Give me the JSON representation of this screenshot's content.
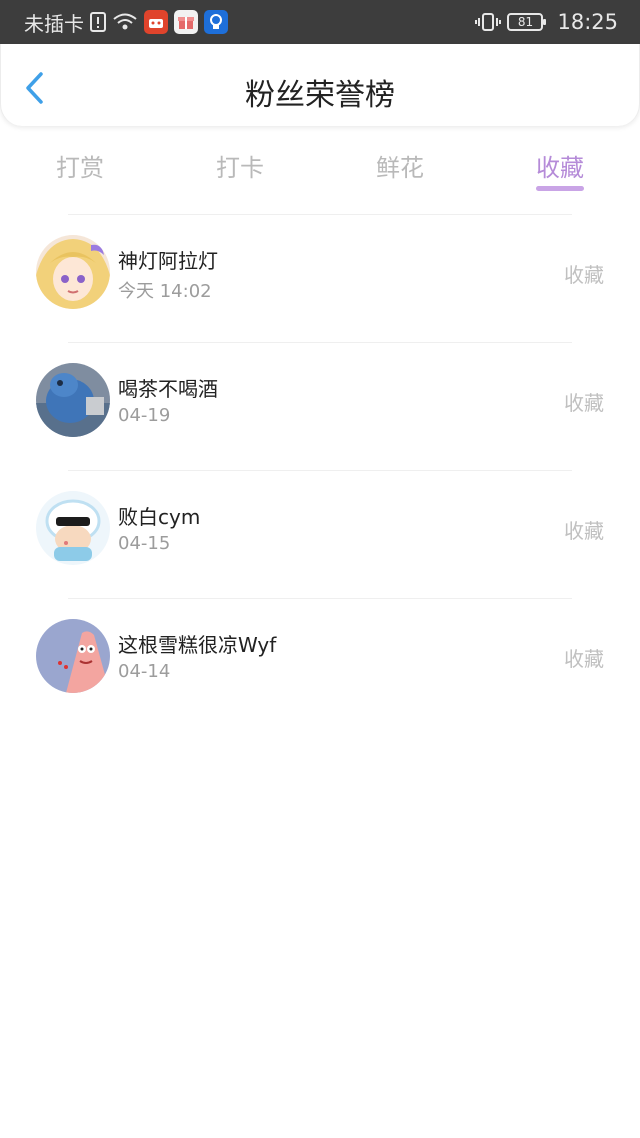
{
  "status_bar": {
    "carrier": "未插卡",
    "battery": "81",
    "time": "18:25"
  },
  "header": {
    "title": "粉丝荣誉榜"
  },
  "tabs": [
    {
      "label": "打赏",
      "active": false
    },
    {
      "label": "打卡",
      "active": false
    },
    {
      "label": "鲜花",
      "active": false
    },
    {
      "label": "收藏",
      "active": true
    }
  ],
  "colors": {
    "accent": "#b58bd8",
    "underline": "#c9a4e6",
    "back_icon": "#3fa0e8",
    "status_bar_bg": "#3d3d3d"
  },
  "list": [
    {
      "name": "神灯阿拉灯",
      "date": "今天 14:02",
      "action": "收藏"
    },
    {
      "name": "喝茶不喝酒",
      "date": "04-19",
      "action": "收藏"
    },
    {
      "name": "败白cym",
      "date": "04-15",
      "action": "收藏"
    },
    {
      "name": "这根雪糕很凉Wyf",
      "date": "04-14",
      "action": "收藏"
    }
  ]
}
